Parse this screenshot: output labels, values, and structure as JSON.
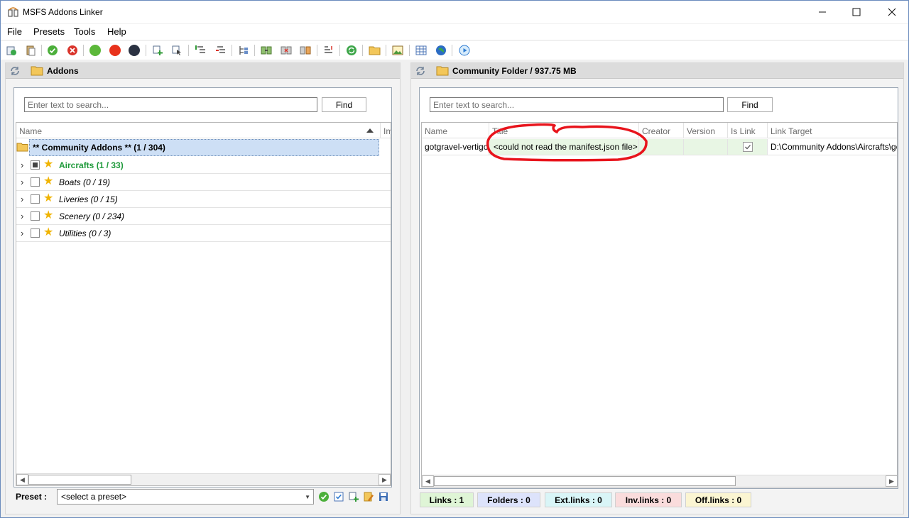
{
  "window": {
    "title": "MSFS Addons Linker"
  },
  "menu": [
    "File",
    "Presets",
    "Tools",
    "Help"
  ],
  "toolbar_icons": [
    "add-addon-icon",
    "paste-icon",
    "check-green-icon",
    "cancel-red-icon",
    "green-dot-icon",
    "red-dot-icon",
    "dark-dot-icon",
    "add-link-icon",
    "select-icon",
    "expand-icon",
    "collapse-icon",
    "filter-tree-icon",
    "link-icon",
    "unlink-icon",
    "relink-icon",
    "sort-icon",
    "refresh-icon",
    "open-folder-icon",
    "image-icon",
    "table-icon",
    "globe-icon",
    "play-icon"
  ],
  "left": {
    "title": "Addons",
    "search_placeholder": "Enter text to search...",
    "find": "Find",
    "columns": [
      "Name",
      "Im"
    ],
    "root": "** Community Addons ** (1 / 304)",
    "items": [
      {
        "label": "Aircrafts (1 / 33)",
        "style": "highlight",
        "checked": "indeterminate"
      },
      {
        "label": "Boats (0 / 19)",
        "style": "italic",
        "checked": "none"
      },
      {
        "label": "Liveries (0 / 15)",
        "style": "italic",
        "checked": "none"
      },
      {
        "label": "Scenery (0 / 234)",
        "style": "italic",
        "checked": "none"
      },
      {
        "label": "Utilities (0 / 3)",
        "style": "italic",
        "checked": "none"
      }
    ],
    "preset_label": "Preset :",
    "preset_value": "<select a preset>"
  },
  "right": {
    "title": "Community Folder / 937.75 MB",
    "search_placeholder": "Enter text to search...",
    "find": "Find",
    "columns": [
      "Name",
      "Title",
      "Creator",
      "Version",
      "Is Link",
      "Link Target"
    ],
    "row": {
      "name": "gotgravel-vertigo",
      "title": "<could not read the manifest.json file>",
      "creator": "",
      "version": "",
      "is_link": true,
      "link_target": "D:\\Community Addons\\Aircrafts\\gotgravel-vertigo"
    },
    "status": [
      {
        "label": "Links : 1",
        "color": "#dff5d6"
      },
      {
        "label": "Folders : 0",
        "color": "#dde3fb"
      },
      {
        "label": "Ext.links : 0",
        "color": "#d9f5f7"
      },
      {
        "label": "Inv.links : 0",
        "color": "#fadcdc"
      },
      {
        "label": "Off.links : 0",
        "color": "#fbf5d2"
      }
    ]
  },
  "colors": {
    "highlight_green": "#1f9a3b",
    "selection": "#cddff5",
    "annotation": "#e8141c"
  }
}
